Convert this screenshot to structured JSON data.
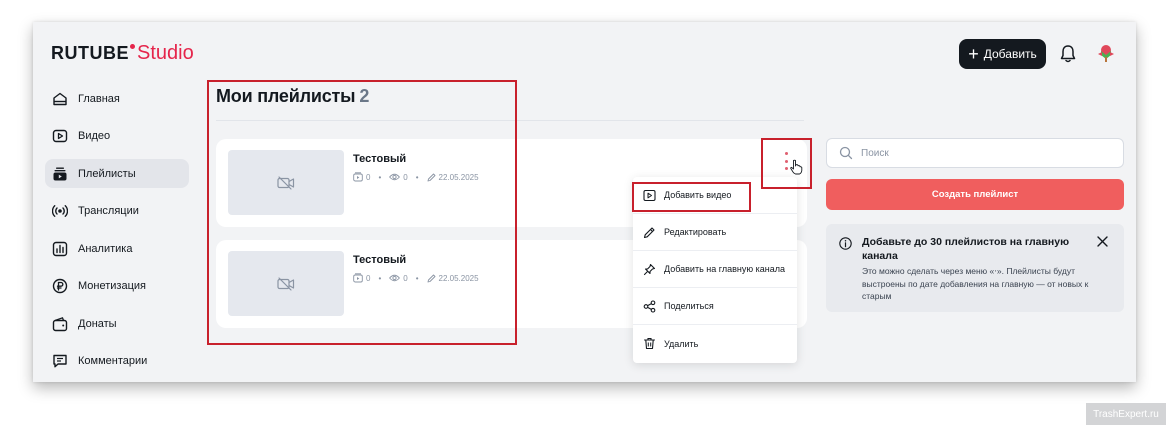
{
  "header": {
    "logo_main": "RUTUBE",
    "logo_sub": "Studio",
    "add_label": "Добавить"
  },
  "sidebar": {
    "items": [
      {
        "label": "Главная",
        "icon": "home-icon",
        "active": false
      },
      {
        "label": "Видео",
        "icon": "video-icon",
        "active": false
      },
      {
        "label": "Плейлисты",
        "icon": "playlist-icon",
        "active": true
      },
      {
        "label": "Трансляции",
        "icon": "broadcast-icon",
        "active": false
      },
      {
        "label": "Аналитика",
        "icon": "analytics-icon",
        "active": false
      },
      {
        "label": "Монетизация",
        "icon": "ruble-icon",
        "active": false
      },
      {
        "label": "Донаты",
        "icon": "wallet-icon",
        "active": false
      },
      {
        "label": "Комментарии",
        "icon": "comment-icon",
        "active": false
      }
    ]
  },
  "main": {
    "title": "Мои плейлисты",
    "count": "2",
    "playlists": [
      {
        "title": "Тестовый",
        "videos": "0",
        "views": "0",
        "date": "22.05.2025"
      },
      {
        "title": "Тестовый",
        "videos": "0",
        "views": "0",
        "date": "22.05.2025"
      }
    ]
  },
  "context_menu": {
    "items": [
      {
        "label": "Добавить видео",
        "icon": "add-video-icon"
      },
      {
        "label": "Редактировать",
        "icon": "pencil-icon"
      },
      {
        "label": "Добавить на главную канала",
        "icon": "pin-icon"
      },
      {
        "label": "Поделиться",
        "icon": "share-icon"
      },
      {
        "label": "Удалить",
        "icon": "trash-icon"
      }
    ]
  },
  "right_panel": {
    "search_placeholder": "Поиск",
    "create_label": "Создать плейлист",
    "info_title": "Добавьте до 30 плейлистов на главную канала",
    "info_text": "Это можно сделать через меню «‧». Плейлисты будут выстроены по дате добавления на главную — от новых к старым"
  },
  "watermark": "TrashExpert.ru",
  "colors": {
    "accent": "#e5254b",
    "create_button": "#f05e5e",
    "highlight": "#c8202c",
    "dark": "#14191f"
  }
}
